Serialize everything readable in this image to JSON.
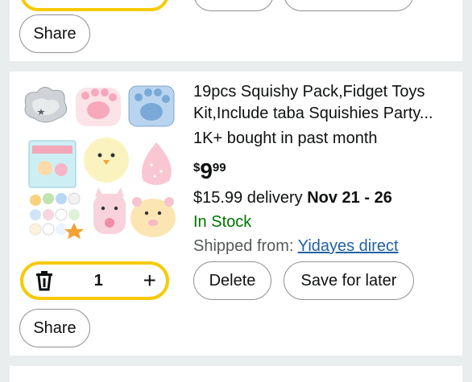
{
  "top_card": {
    "share_label": "Share"
  },
  "product": {
    "title_line1": "19pcs Squishy Pack,Fidget Toys",
    "title_line2": "Kit,Include taba Squishies Party...",
    "bought": "1K+ bought in past month",
    "price": {
      "symbol": "$",
      "whole": "9",
      "fraction": "99"
    },
    "delivery_fee": "$15.99 delivery",
    "delivery_dates": "Nov 21 - 26",
    "stock": "In Stock",
    "shipped_label": "Shipped from:",
    "shipped_seller": "Yidayes direct",
    "quantity": "1",
    "delete_label": "Delete",
    "save_label": "Save for later",
    "share_label": "Share",
    "icons": {
      "delete": "trash-icon",
      "add": "plus-icon"
    }
  },
  "colors": {
    "background": "#eaeded",
    "quantity_border": "#f7ca00",
    "in_stock": "#007600",
    "link": "#2162a1"
  }
}
